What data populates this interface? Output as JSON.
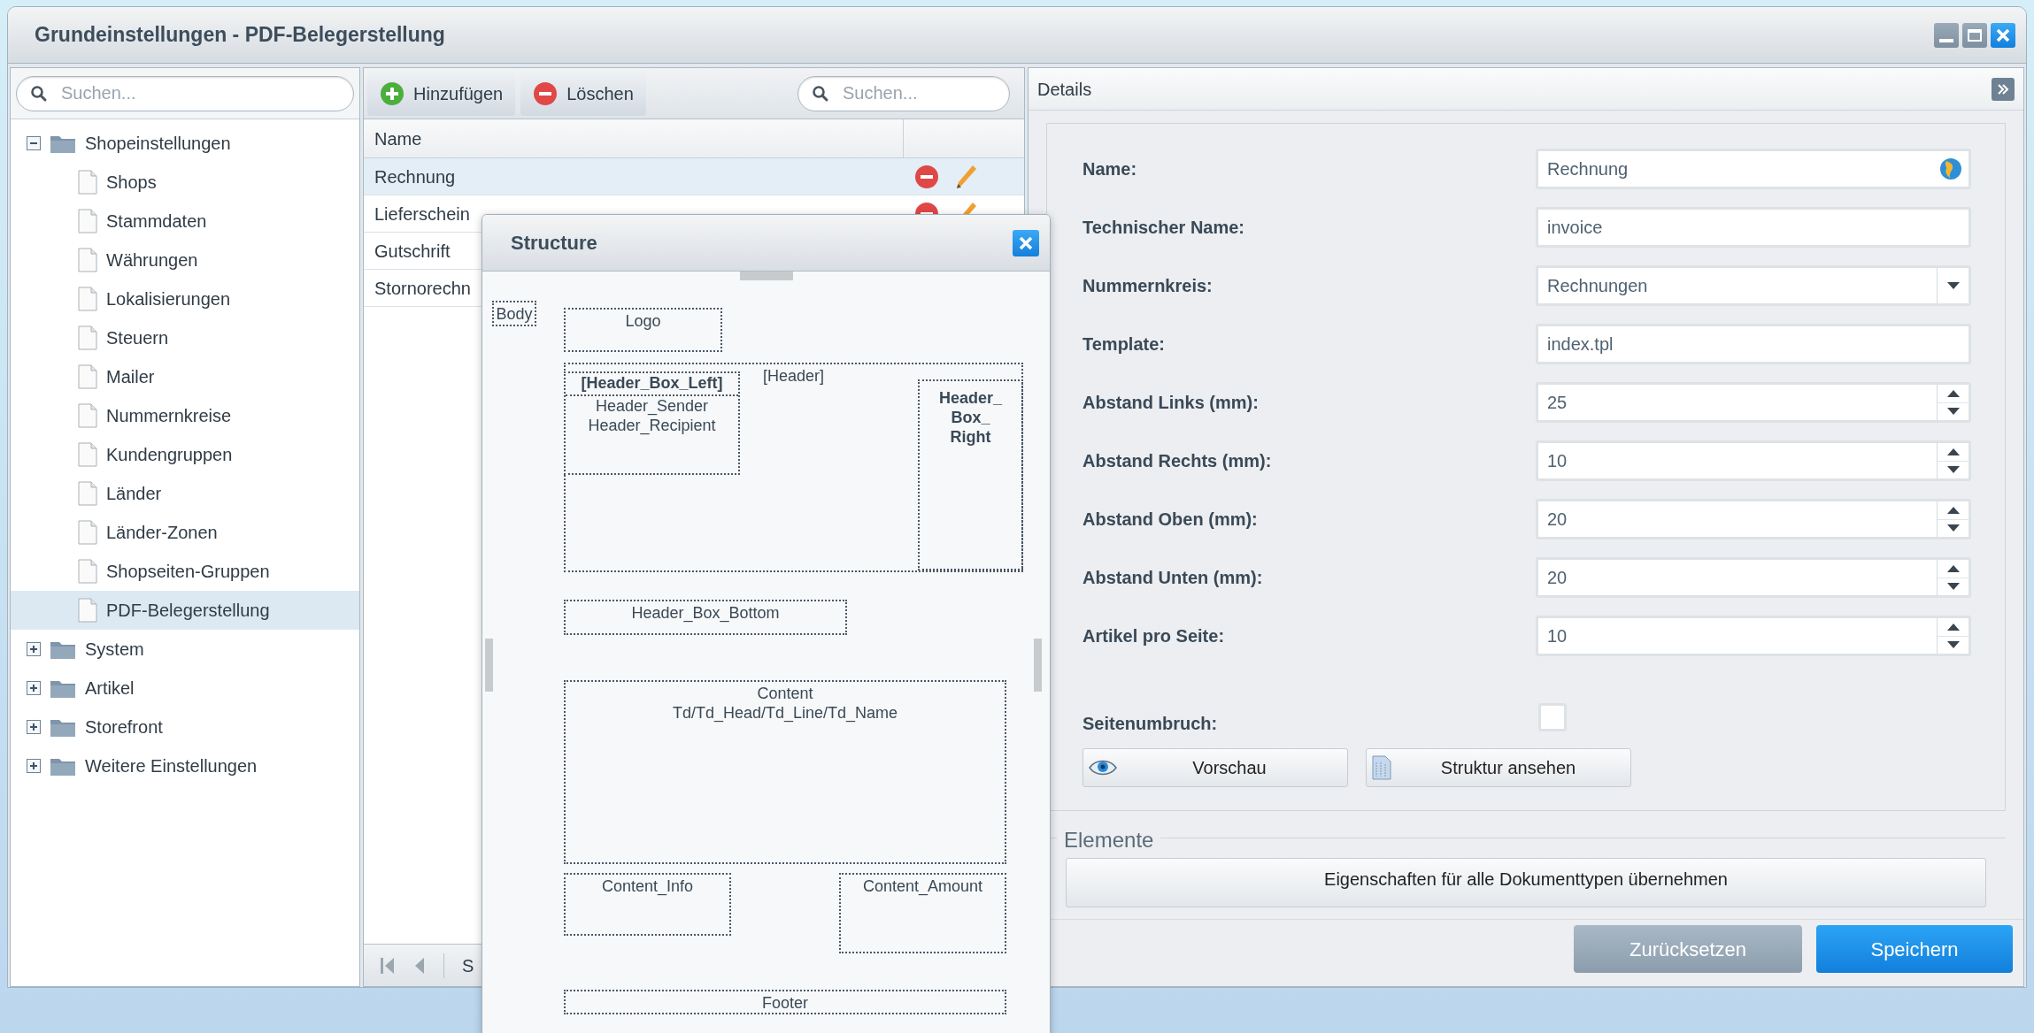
{
  "window": {
    "title": "Grundeinstellungen - PDF-Belegerstellung"
  },
  "tree": {
    "search": {
      "placeholder": "Suchen..."
    },
    "items": [
      {
        "label": "Shopeinstellungen",
        "expanded": true,
        "selected": false,
        "children": [
          {
            "label": "Shops",
            "selected": false
          },
          {
            "label": "Stammdaten",
            "selected": false
          },
          {
            "label": "Währungen",
            "selected": false
          },
          {
            "label": "Lokalisierungen",
            "selected": false
          },
          {
            "label": "Steuern",
            "selected": false
          },
          {
            "label": "Mailer",
            "selected": false
          },
          {
            "label": "Nummernkreise",
            "selected": false
          },
          {
            "label": "Kundengruppen",
            "selected": false
          },
          {
            "label": "Länder",
            "selected": false
          },
          {
            "label": "Länder-Zonen",
            "selected": false
          },
          {
            "label": "Shopseiten-Gruppen",
            "selected": false
          },
          {
            "label": "PDF-Belegerstellung",
            "selected": true
          }
        ]
      },
      {
        "label": "System",
        "expanded": false,
        "selected": false
      },
      {
        "label": "Artikel",
        "expanded": false,
        "selected": false
      },
      {
        "label": "Storefront",
        "expanded": false,
        "selected": false
      },
      {
        "label": "Weitere Einstellungen",
        "expanded": false,
        "selected": false
      }
    ]
  },
  "list": {
    "toolbar": [
      {
        "label": "Hinzufügen",
        "kind": "add"
      },
      {
        "label": "Löschen",
        "kind": "delete"
      }
    ],
    "search": {
      "placeholder": "Suchen..."
    },
    "columns": [
      "Name"
    ],
    "rows": [
      {
        "name": "Rechnung",
        "selected": true
      },
      {
        "name": "Lieferschein",
        "selected": false
      },
      {
        "name": "Gutschrift",
        "selected": false
      },
      {
        "name": "Stornorechn",
        "selected": false
      }
    ],
    "pager": {
      "text": "S"
    }
  },
  "details": {
    "title": "Details",
    "fields": [
      {
        "label": "Name:",
        "value": "Rechnung",
        "kind": "translatable"
      },
      {
        "label": "Technischer Name:",
        "value": "invoice",
        "kind": "text"
      },
      {
        "label": "Nummernkreis:",
        "value": "Rechnungen",
        "kind": "combo"
      },
      {
        "label": "Template:",
        "value": "index.tpl",
        "kind": "text"
      },
      {
        "label": "Abstand Links (mm):",
        "value": "25",
        "kind": "number"
      },
      {
        "label": "Abstand Rechts (mm):",
        "value": "10",
        "kind": "number"
      },
      {
        "label": "Abstand Oben (mm):",
        "value": "20",
        "kind": "number"
      },
      {
        "label": "Abstand Unten (mm):",
        "value": "20",
        "kind": "number"
      },
      {
        "label": "Artikel pro Seite:",
        "value": "10",
        "kind": "number"
      }
    ],
    "checkbox": {
      "label": "Seitenumbruch:",
      "checked": false
    },
    "buttons": [
      {
        "label": "Vorschau",
        "kind": "preview"
      },
      {
        "label": "Struktur ansehen",
        "kind": "structure"
      }
    ],
    "elements": {
      "title": "Elemente",
      "button": "Eigenschaften für alle Dokumenttypen übernehmen"
    },
    "footer_buttons": [
      {
        "label": "Zurücksetzen",
        "kind": "secondary"
      },
      {
        "label": "Speichern",
        "kind": "primary"
      }
    ]
  },
  "structure": {
    "title": "Structure",
    "boxes": [
      {
        "kind": "body",
        "title": "Body"
      },
      {
        "kind": "logo",
        "title": "Logo"
      },
      {
        "kind": "header",
        "title": "[Header]"
      },
      {
        "kind": "header_box_left",
        "title": "[Header_Box_Left]",
        "lines": [
          "Header_Sender",
          "Header_Recipient"
        ]
      },
      {
        "kind": "header_box_right",
        "title_lines": [
          "Header_",
          "Box_",
          "Right"
        ]
      },
      {
        "kind": "header_box_bottom",
        "title": "Header_Box_Bottom"
      },
      {
        "kind": "content",
        "title": "Content",
        "lines": [
          "Td/Td_Head/Td_Line/Td_Name"
        ]
      },
      {
        "kind": "content_info",
        "title": "Content_Info"
      },
      {
        "kind": "content_amount",
        "title": "Content_Amount"
      },
      {
        "kind": "footer",
        "title": "Footer"
      }
    ]
  }
}
